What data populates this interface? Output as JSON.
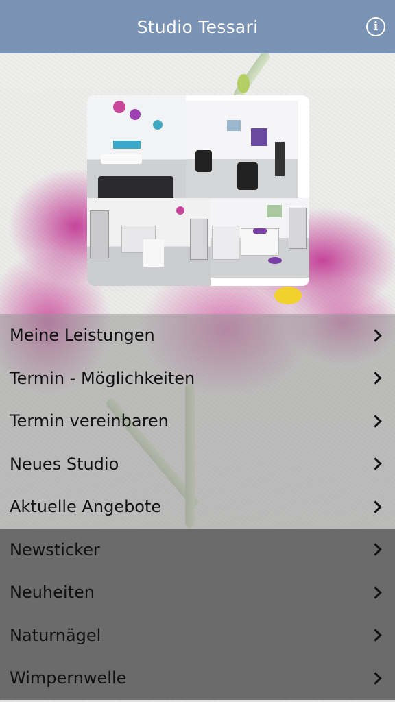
{
  "header": {
    "title": "Studio Tessari",
    "info_icon": "info-icon"
  },
  "collage": {
    "description_icon": "studio-photo-collage"
  },
  "menu": {
    "items": [
      {
        "label": "Meine Leistungen"
      },
      {
        "label": "Termin - Möglichkeiten"
      },
      {
        "label": "Termin vereinbaren"
      },
      {
        "label": "Neues Studio"
      },
      {
        "label": "Aktuelle Angebote"
      },
      {
        "label": "Newsticker"
      },
      {
        "label": "Neuheiten"
      },
      {
        "label": "Naturnägel"
      },
      {
        "label": "Wimpernwelle"
      }
    ]
  },
  "colors": {
    "header": "#748eb2",
    "menu_light": "#969696",
    "menu_dark": "#646464",
    "text": "#111111"
  }
}
